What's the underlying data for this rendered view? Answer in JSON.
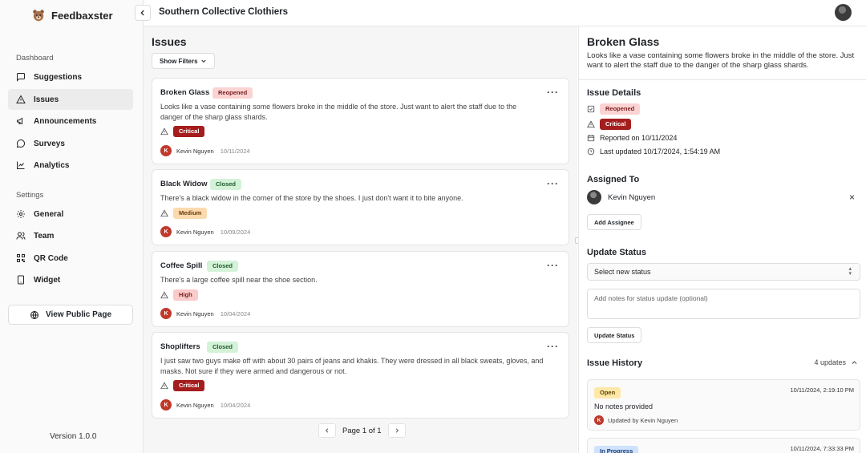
{
  "app": {
    "name": "Feedbaxster",
    "version": "Version 1.0.0"
  },
  "org": {
    "name": "Southern Collective Clothiers"
  },
  "sidebar": {
    "dashboard_label": "Dashboard",
    "settings_label": "Settings",
    "dashboard_items": [
      {
        "label": "Suggestions",
        "icon": "message-square-icon"
      },
      {
        "label": "Issues",
        "icon": "alert-triangle-icon",
        "active": true
      },
      {
        "label": "Announcements",
        "icon": "megaphone-icon"
      },
      {
        "label": "Surveys",
        "icon": "message-circle-icon"
      },
      {
        "label": "Analytics",
        "icon": "line-chart-icon"
      }
    ],
    "settings_items": [
      {
        "label": "General",
        "icon": "gear-icon"
      },
      {
        "label": "Team",
        "icon": "users-icon"
      },
      {
        "label": "QR Code",
        "icon": "qr-code-icon"
      },
      {
        "label": "Widget",
        "icon": "tablet-icon"
      }
    ],
    "public_page_label": "View Public Page"
  },
  "issues": {
    "title": "Issues",
    "filter_label": "Show Filters",
    "list": [
      {
        "title": "Broken Glass",
        "status": "Reopened",
        "description": "Looks like a vase containing some flowers broke in the middle of the store. Just want to alert the staff due to the danger of the sharp glass shards.",
        "severity": "Critical",
        "author": "Kevin Nguyen",
        "author_initial": "K",
        "date": "10/11/2024",
        "menu": "···"
      },
      {
        "title": "Black Widow",
        "status": "Closed",
        "description": "There's a black widow in the corner of the store by the shoes. I just don't want it to bite anyone.",
        "severity": "Medium",
        "author": "Kevin Nguyen",
        "author_initial": "K",
        "date": "10/09/2024",
        "menu": "···"
      },
      {
        "title": "Coffee Spill",
        "status": "Closed",
        "description": "There's a large coffee spill near the shoe section.",
        "severity": "High",
        "author": "Kevin Nguyen",
        "author_initial": "K",
        "date": "10/04/2024",
        "menu": "···"
      },
      {
        "title": "Shoplifters",
        "status": "Closed",
        "description": "I just saw two guys make off with about 30 pairs of jeans and khakis. They were dressed in all black sweats, gloves, and masks. Not sure if they were armed and dangerous or not.",
        "severity": "Critical",
        "author": "Kevin Nguyen",
        "author_initial": "K",
        "date": "10/04/2024",
        "menu": "···"
      }
    ],
    "pagination": {
      "label": "Page 1 of 1"
    }
  },
  "detail": {
    "title": "Broken Glass",
    "description": "Looks like a vase containing some flowers broke in the middle of the store. Just want to alert the staff due to the danger of the sharp glass shards.",
    "details_heading": "Issue Details",
    "status": "Reopened",
    "severity": "Critical",
    "reported": "Reported on 10/11/2024",
    "updated": "Last updated 10/17/2024, 1:54:19 AM",
    "assigned_heading": "Assigned To",
    "assignee": "Kevin Nguyen",
    "remove": "×",
    "add_assignee_label": "Add Assignee",
    "update_heading": "Update Status",
    "select_placeholder": "Select new status",
    "notes_placeholder": "Add notes for status update (optional)",
    "update_button": "Update Status",
    "history_heading": "Issue History",
    "history_count": "4 updates",
    "history": [
      {
        "status": "Open",
        "time": "10/11/2024, 2:19:10 PM",
        "note": "No notes provided",
        "by": "Updated by Kevin Nguyen",
        "initial": "K"
      },
      {
        "status": "In Progress",
        "time": "10/11/2024, 7:33:33 PM"
      }
    ]
  },
  "colors": {
    "critical": "#a51d1d",
    "reopened": "#fbd3d3",
    "closed": "#d4f2d8",
    "medium": "#fcd9ae",
    "high": "#fbcaca",
    "open": "#fde8a7",
    "in_progress": "#cfe2ff"
  }
}
